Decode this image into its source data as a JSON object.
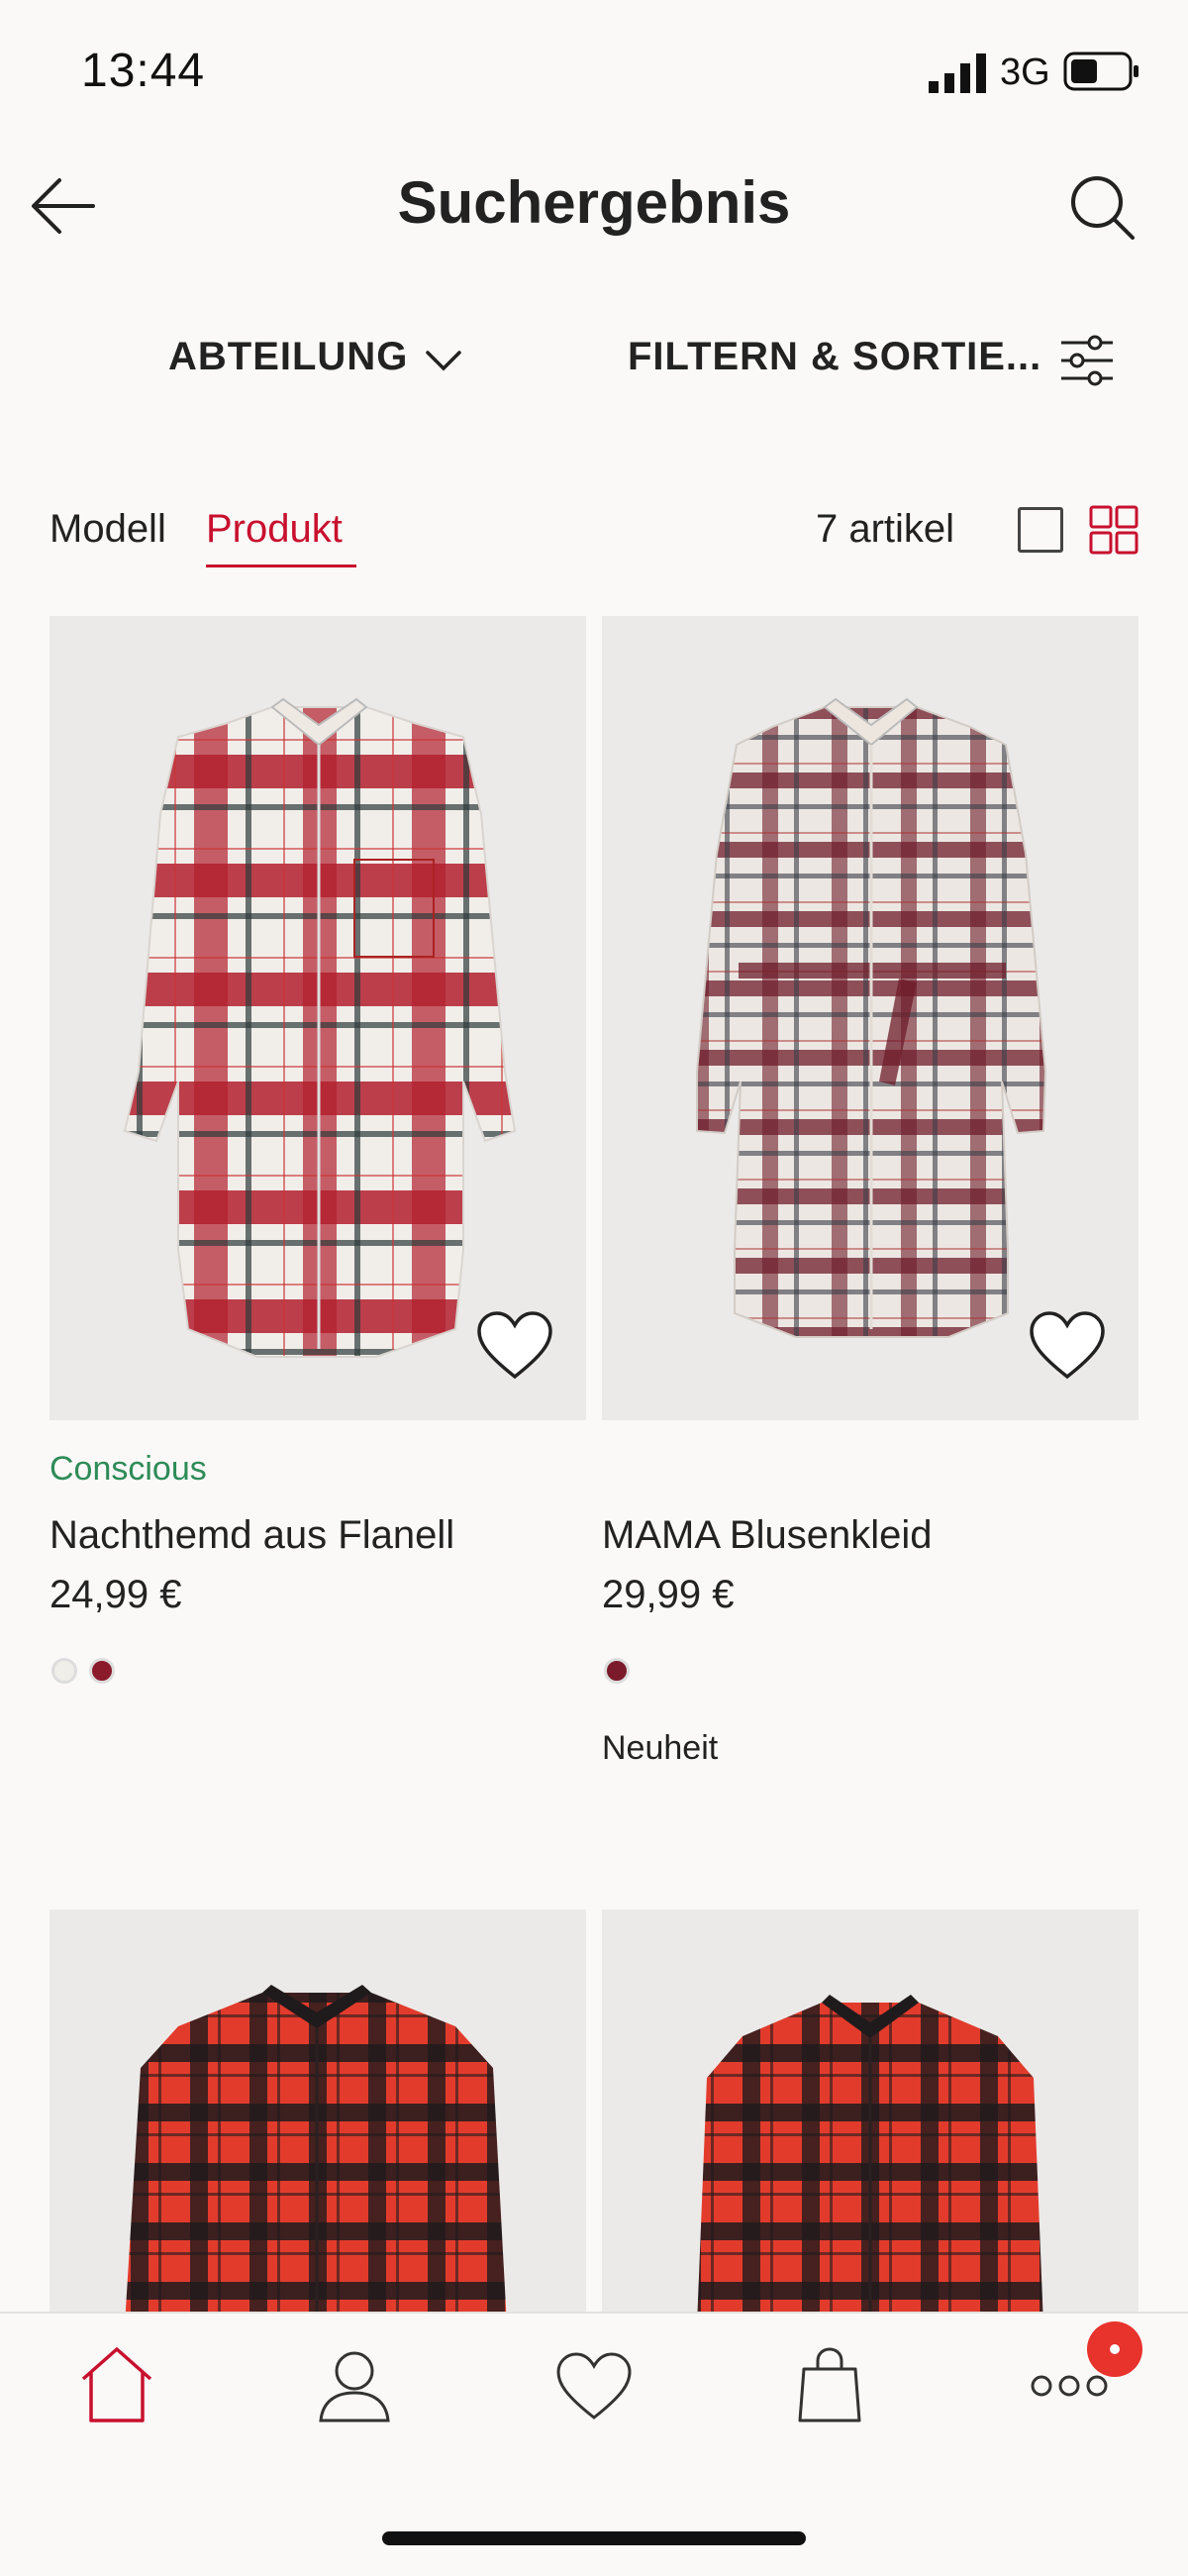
{
  "status_bar": {
    "time": "13:44",
    "network": "3G"
  },
  "header": {
    "title": "Suchergebnis"
  },
  "filters": {
    "department_label": "ABTEILUNG",
    "filter_sort_label": "FILTERN & SORTIE..."
  },
  "view_tabs": {
    "model_label": "Modell",
    "product_label": "Produkt",
    "active": "Produkt"
  },
  "result_count": "7 artikel",
  "colors": {
    "accent": "#c8102e",
    "conscious_green": "#2e8b57"
  },
  "products": [
    {
      "tag": "Conscious",
      "name": "Nachthemd aus Flanell",
      "price": "24,99 €",
      "swatches": [
        "#efeee9",
        "#8b1a2b"
      ],
      "badge": ""
    },
    {
      "tag": "",
      "name": "MAMA Blusenkleid",
      "price": "29,99 €",
      "swatches": [
        "#7a1a2a"
      ],
      "badge": "Neuheit"
    }
  ],
  "bottom_nav": [
    "home-icon",
    "profile-icon",
    "favorites-icon",
    "bag-icon",
    "more-icon"
  ]
}
